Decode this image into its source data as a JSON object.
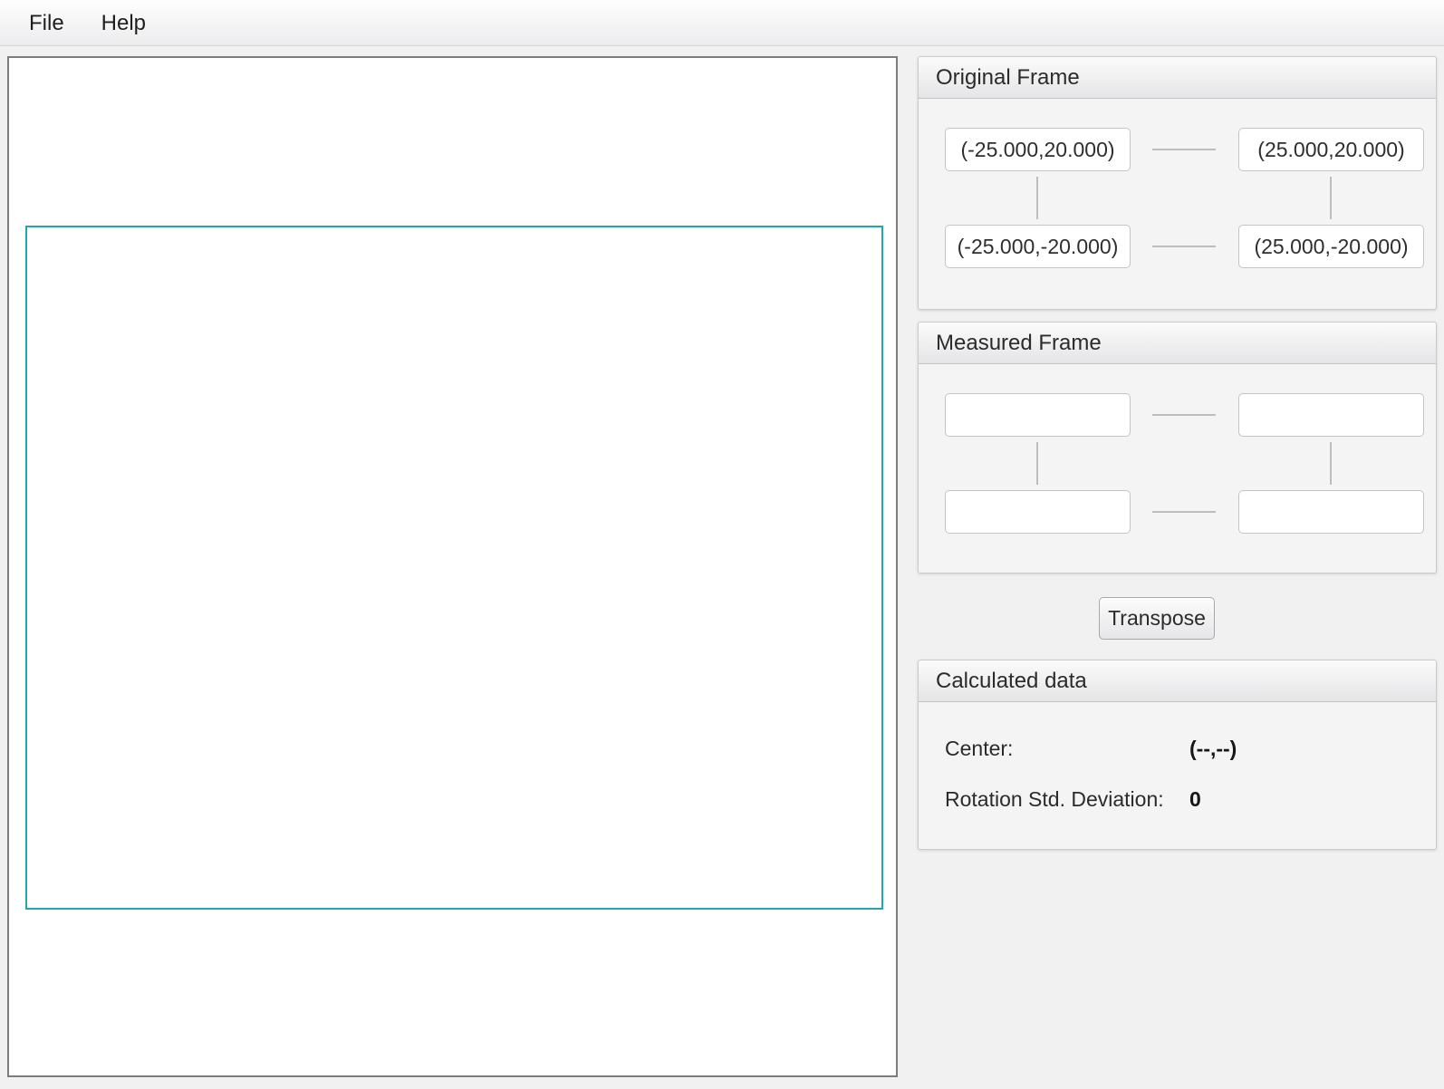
{
  "menu": {
    "items": [
      {
        "label": "File"
      },
      {
        "label": "Help"
      }
    ]
  },
  "canvas": {
    "frame_stroke_color": "#1da8aa"
  },
  "original_frame": {
    "title": "Original Frame",
    "corners": {
      "top_left": "(-25.000,20.000)",
      "top_right": "(25.000,20.000)",
      "bottom_left": "(-25.000,-20.000)",
      "bottom_right": "(25.000,-20.000)"
    }
  },
  "measured_frame": {
    "title": "Measured Frame",
    "corners": {
      "top_left": "",
      "top_right": "",
      "bottom_left": "",
      "bottom_right": ""
    }
  },
  "actions": {
    "transpose_label": "Transpose"
  },
  "calculated_data": {
    "title": "Calculated data",
    "center_label": "Center:",
    "center_value": "(--,--)",
    "rotation_label": "Rotation Std. Deviation:",
    "rotation_value": "0"
  }
}
